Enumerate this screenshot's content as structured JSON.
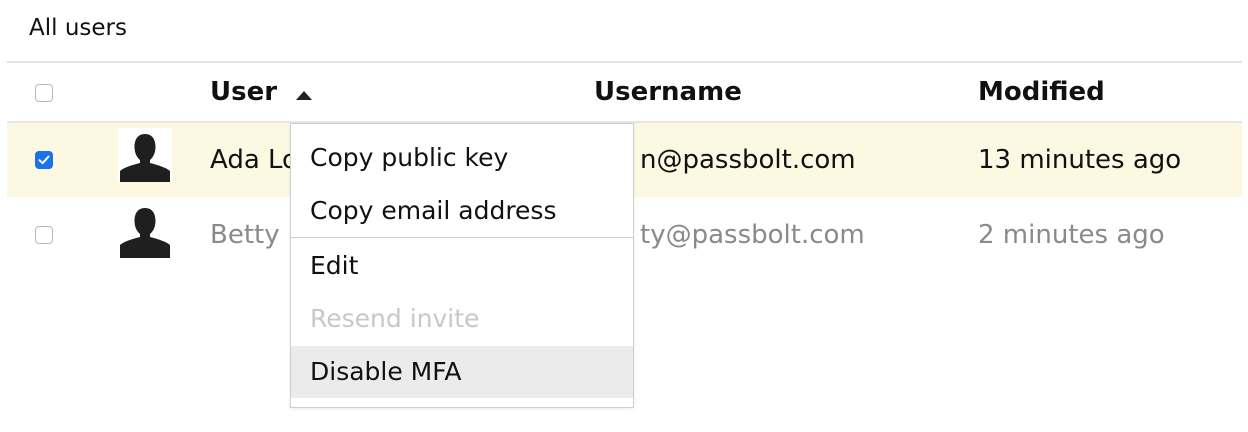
{
  "breadcrumb": "All users",
  "table": {
    "columns": {
      "user": "User",
      "username": "Username",
      "modified": "Modified"
    },
    "sort": {
      "column": "User",
      "direction": "ascending",
      "icon": "sort-up-icon"
    },
    "rows": [
      {
        "name": "Ada Lo",
        "username": "n@passbolt.com",
        "modified": "13 minutes ago",
        "selected": true,
        "avatar": "default-user-avatar"
      },
      {
        "name": "Betty E",
        "username": "ty@passbolt.com",
        "modified": "2 minutes ago",
        "selected": false,
        "avatar": "default-user-avatar"
      }
    ]
  },
  "context_menu": {
    "items": [
      {
        "label": "Copy public key",
        "enabled": true
      },
      {
        "label": "Copy email address",
        "enabled": true
      },
      {
        "label": "Edit",
        "enabled": true
      },
      {
        "label": "Resend invite",
        "enabled": false
      },
      {
        "label": "Disable MFA",
        "enabled": true,
        "hovered": true
      }
    ]
  },
  "colors": {
    "checkbox_checked": "#1a73e8",
    "row_selected": "#fdf8e2",
    "menu_hover": "#ebebeb",
    "disabled_text": "#c8c8c8",
    "inactive_text": "#8a8a8a"
  }
}
